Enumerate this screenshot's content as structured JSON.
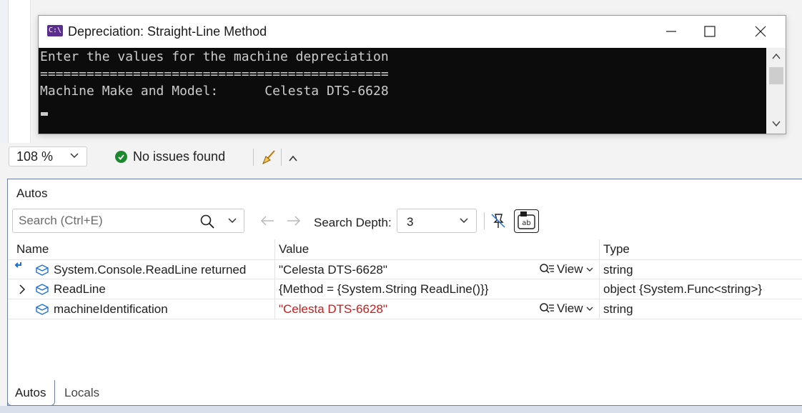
{
  "console": {
    "title": "Depreciation: Straight-Line Method",
    "icon_text": "C:\\",
    "lines": [
      "Enter the values for the machine depreciation",
      "=============================================",
      "Machine Make and Model:      Celesta DTS-6628"
    ]
  },
  "status": {
    "zoom": "108 %",
    "issues": "No issues found"
  },
  "autos": {
    "title": "Autos",
    "search_placeholder": "Search (Ctrl+E)",
    "search_depth_label": "Search Depth:",
    "search_depth_value": "3",
    "columns": {
      "name": "Name",
      "value": "Value",
      "type": "Type"
    },
    "rows": [
      {
        "name": "System.Console.ReadLine returned",
        "value": "\"Celesta DTS-6628\"",
        "view": "View",
        "type": "string"
      },
      {
        "name": "ReadLine",
        "value": "{Method = {System.String ReadLine()}}",
        "type": "object {System.Func<string>}"
      },
      {
        "name": "machineIdentification",
        "value": "\"Celesta DTS-6628\"",
        "view": "View",
        "type": "string"
      }
    ]
  },
  "tabs": [
    "Autos",
    "Locals"
  ],
  "colors": {
    "accent": "#5c2d91",
    "ok": "#1b8a2e",
    "changed_value": "#d01818",
    "panel_border": "#6b7fa8"
  }
}
